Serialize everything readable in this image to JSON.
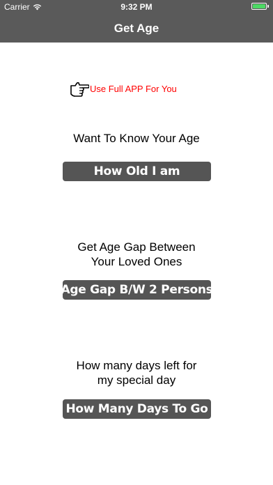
{
  "status": {
    "carrier": "Carrier",
    "time": "9:32 PM"
  },
  "nav": {
    "title": "Get Age"
  },
  "promo": {
    "icon": "pointing-hand-icon",
    "text": "Use Full APP For You"
  },
  "sections": [
    {
      "label_line1": "Want To Know Your Age",
      "label_line2": "",
      "button": "How Old I am"
    },
    {
      "label_line1": "Get Age Gap Between",
      "label_line2": "Your Loved Ones",
      "button": "Age Gap B/W 2 Persons"
    },
    {
      "label_line1": "How many days left for",
      "label_line2": "my special day",
      "button": "How Many Days To Go"
    }
  ],
  "colors": {
    "bar": "#5a5a5a",
    "button": "#555555",
    "promo_text": "#ff0000",
    "battery": "#4cd964"
  }
}
